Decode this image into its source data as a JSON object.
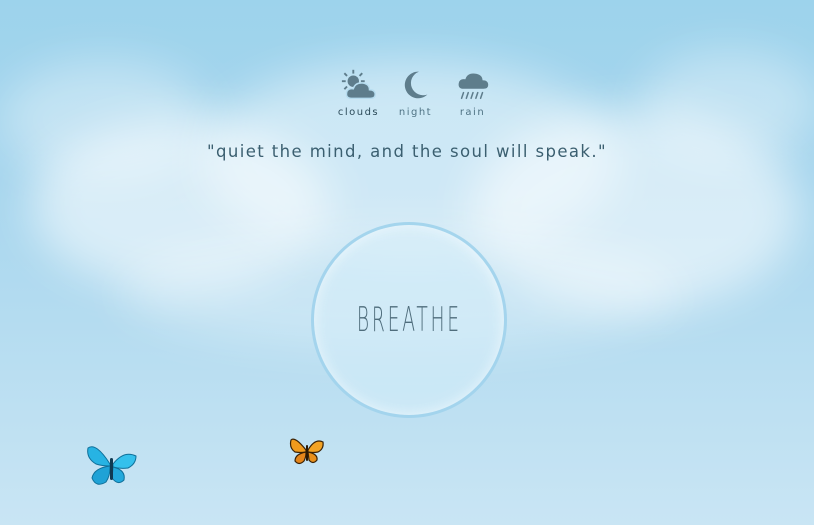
{
  "weather": {
    "items": [
      {
        "id": "clouds",
        "label": "clouds",
        "icon": "sun-cloud-icon"
      },
      {
        "id": "night",
        "label": "night",
        "icon": "moon-icon"
      },
      {
        "id": "rain",
        "label": "rain",
        "icon": "rain-cloud-icon"
      }
    ],
    "active": "clouds"
  },
  "quote": "\"quiet the mind, and the soul will speak.\"",
  "breathe": {
    "label": "BREATHE"
  },
  "colors": {
    "sky_top": "#9dd3ec",
    "sky_bottom": "#c9e5f4",
    "icon": "#5e7d8c",
    "text": "#3b5f70",
    "circle_ring": "#a0d2ec"
  },
  "decorations": {
    "butterflies": [
      {
        "name": "blue-butterfly",
        "color": "#2bb6e0"
      },
      {
        "name": "orange-butterfly",
        "color": "#e8921c"
      }
    ]
  }
}
